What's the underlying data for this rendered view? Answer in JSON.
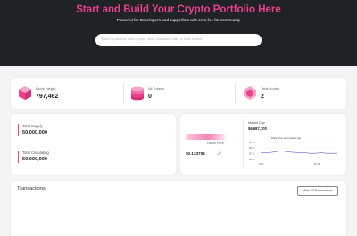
{
  "hero": {
    "title": "Start and Build Your Crypto Portfolio Here",
    "subtitle": "Powerful for Developers and supperfast with zero fee for community",
    "search_placeholder": "Search by address, token symbol, name, transaction hash, or block number"
  },
  "stats": [
    {
      "label": "Block Height",
      "value": "797,462",
      "icon": "cube-stack-icon"
    },
    {
      "label": "All Tokens",
      "value": "0",
      "icon": "coin-stack-icon"
    },
    {
      "label": "Total Nodes",
      "value": "2",
      "icon": "node-hexagon-icon"
    }
  ],
  "supply": {
    "total_supply_label": "Total Supply",
    "total_supply_value": "50,000,000",
    "total_circulating_label": "Total Circulating",
    "total_circulating_value": "50,000,000"
  },
  "market": {
    "latest_price_label": "Latest Price",
    "latest_price_value": "$0.133754",
    "market_cap_label": "Market Cap",
    "market_cap_value": "$6,687,700"
  },
  "chart_data": {
    "type": "line",
    "title": "Daily price and market cap",
    "y_ticks": [
      "$0.36",
      "$0.24",
      "$0.12",
      "$0.00"
    ],
    "x_ticks": [
      "Jul 6",
      "Jul 16"
    ],
    "ylim": [
      0,
      0.36
    ],
    "x": [
      "Jul 6",
      "Jul 7",
      "Jul 8",
      "Jul 9",
      "Jul 10",
      "Jul 11",
      "Jul 12",
      "Jul 13",
      "Jul 14",
      "Jul 15",
      "Jul 16",
      "Jul 17",
      "Jul 18",
      "Jul 19",
      "Jul 20"
    ],
    "series": [
      {
        "values": [
          0.14,
          0.14,
          0.15,
          0.17,
          0.18,
          0.16,
          0.15,
          0.14,
          0.14,
          0.13,
          0.13,
          0.14,
          0.13,
          0.13,
          0.13
        ]
      }
    ],
    "line_color": "#7b61c9"
  },
  "transactions": {
    "title": "Transactions",
    "view_all_label": "View All Transactions"
  },
  "colors": {
    "accent": "#ec3f8c",
    "hero_bg": "#1f2326"
  }
}
